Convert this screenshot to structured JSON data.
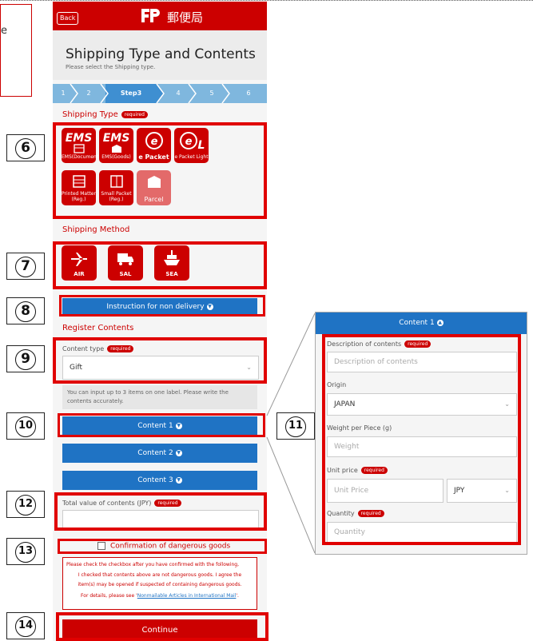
{
  "callout_text": "e",
  "header": {
    "back_label": "Back",
    "brand": "郵便局"
  },
  "page": {
    "title": "Shipping Type and Contents",
    "subtitle": "Please select the Shipping type."
  },
  "steps": [
    "1",
    "2",
    "Step3",
    "4",
    "5",
    "6"
  ],
  "required_badge": "required",
  "shipping_type": {
    "heading": "Shipping Type",
    "tiles": [
      {
        "icon": "EMS",
        "label": "EMS(Document)",
        "selected": false
      },
      {
        "icon": "EMS",
        "label": "EMS(Goods)",
        "selected": false
      },
      {
        "icon": "e",
        "label": "e Packet",
        "selected": false
      },
      {
        "icon": "eL",
        "label": "e Packet Light",
        "selected": false
      },
      {
        "icon": "box",
        "label": "Printed Matter (Reg.)",
        "selected": false
      },
      {
        "icon": "box",
        "label": "Small Packet (Reg.)",
        "selected": false
      },
      {
        "icon": "box",
        "label": "Parcel",
        "selected": true
      }
    ]
  },
  "shipping_method": {
    "heading": "Shipping Method",
    "tiles": [
      {
        "icon": "airplane-icon",
        "label": "AIR"
      },
      {
        "icon": "truck-icon",
        "label": "SAL"
      },
      {
        "icon": "ship-icon",
        "label": "SEA"
      }
    ]
  },
  "non_delivery_label": "Instruction for non delivery",
  "register": {
    "heading": "Register Contents",
    "content_type_label": "Content type",
    "content_type_value": "Gift",
    "note": "You can input up to 3 items on one label. Please write the contents accurately.",
    "contents": [
      "Content 1",
      "Content 2",
      "Content 3"
    ],
    "total_label": "Total value of contents (JPY)"
  },
  "danger": {
    "label": "Confirmation of dangerous goods",
    "line1": "Please check the checkbox after you have confirmed with the following,",
    "line2": "I checked that contents above are not dangerous goods. I agree the",
    "line3": "item(s) may be opened if suspected of containing dangerous goods.",
    "line4_prefix": "For details, please see '",
    "line4_link": "Nonmailable Articles in International Mail",
    "line4_suffix": "'."
  },
  "continue_label": "Continue",
  "zoom": {
    "header": "Content 1",
    "description_label": "Description of contents",
    "description_placeholder": "Description of contents",
    "origin_label": "Origin",
    "origin_value": "JAPAN",
    "weight_label": "Weight per Piece (g)",
    "weight_placeholder": "Weight",
    "unit_price_label": "Unit price",
    "unit_price_placeholder": "Unit Price",
    "currency_value": "JPY",
    "quantity_label": "Quantity",
    "quantity_placeholder": "Quantity"
  },
  "markers": [
    "6",
    "7",
    "8",
    "9",
    "10",
    "11",
    "12",
    "13",
    "14"
  ],
  "colors": {
    "brand_red": "#cc0000",
    "blue": "#1f73c4",
    "step_blue": "#7fb7de",
    "highlight_red": "#e00000"
  }
}
